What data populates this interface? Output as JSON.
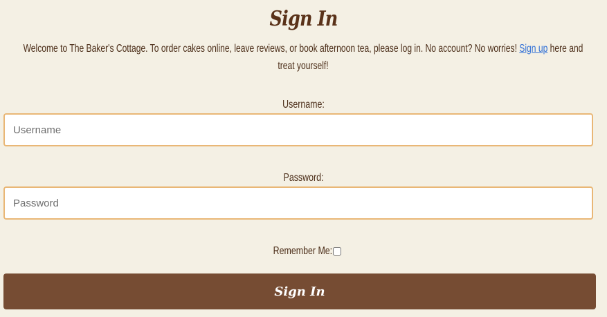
{
  "page": {
    "title": "Sign In"
  },
  "intro": {
    "text_before": "Welcome to The Baker's Cottage. To order cakes online, leave reviews, or book afternoon tea, please log in. No account? No worries! ",
    "signup_link": "Sign up",
    "text_after": " here and treat yourself!"
  },
  "form": {
    "username_label": "Username:",
    "username_placeholder": "Username",
    "password_label": "Password:",
    "password_placeholder": "Password",
    "remember_label": "Remember Me:",
    "remember_checked": false,
    "submit_label": "Sign In"
  },
  "colors": {
    "background": "#f4f0e4",
    "button": "#764c33",
    "input_border": "#e9b776",
    "link": "#2f6fd6",
    "text": "#4a2c17"
  }
}
